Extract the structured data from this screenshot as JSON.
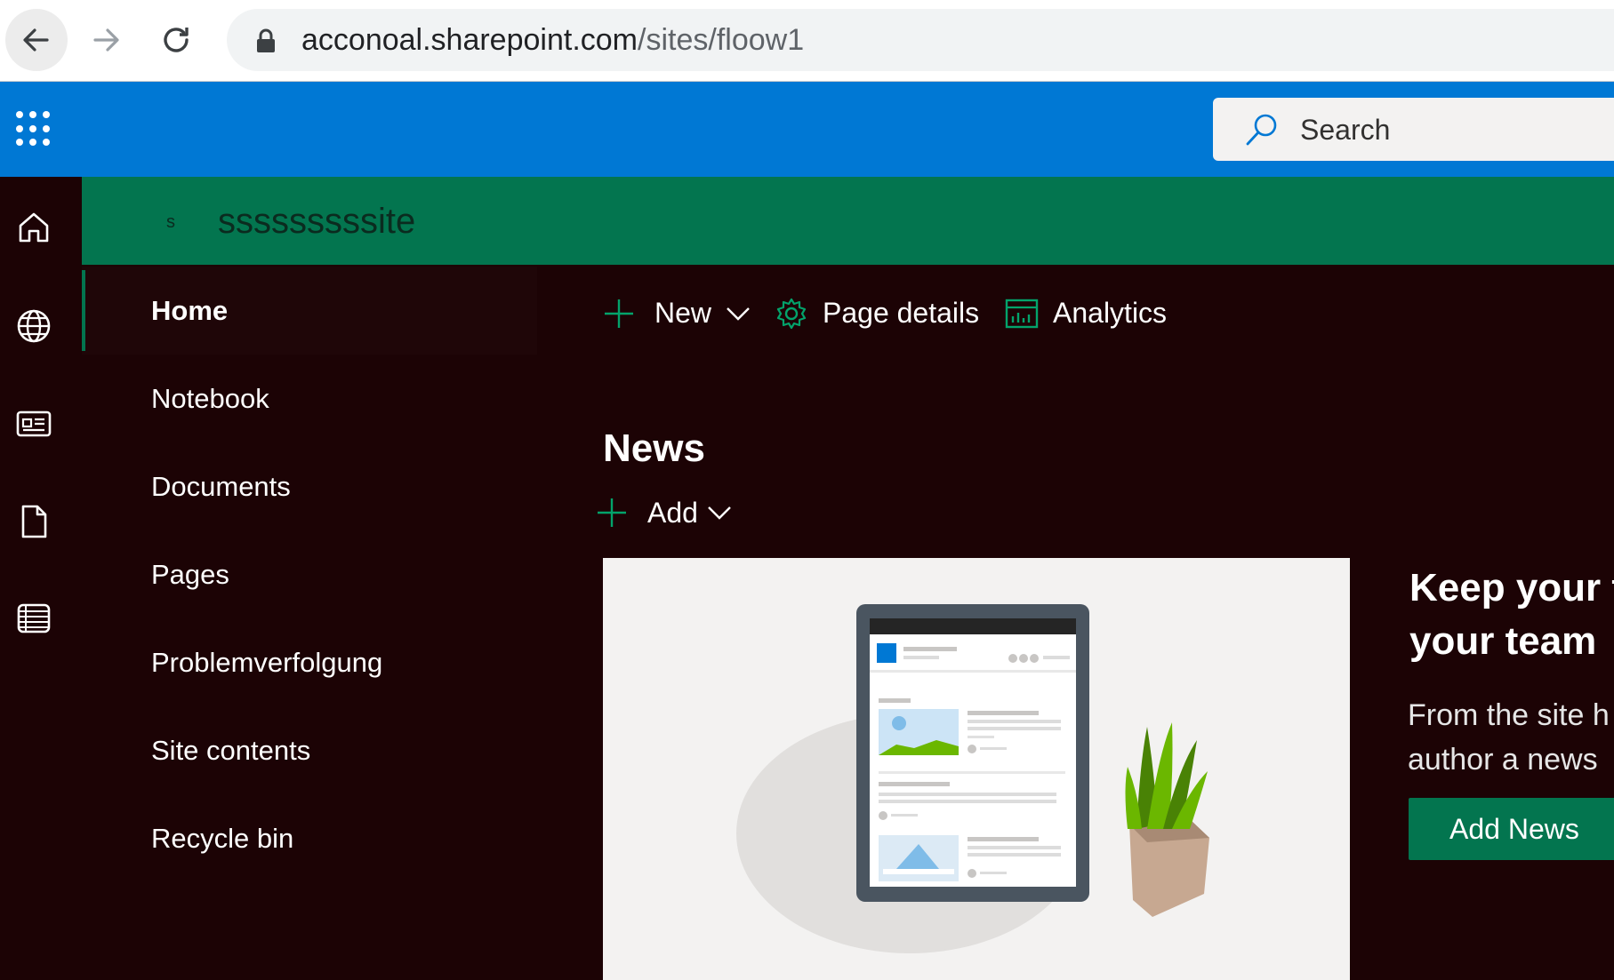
{
  "browser": {
    "url_host": "acconoal.sharepoint.com",
    "url_path": "/sites/floow1"
  },
  "suite_bar": {
    "search_placeholder": "Search"
  },
  "site": {
    "logo_letter": "s",
    "title": "sssssssssite"
  },
  "left_nav": {
    "items": [
      {
        "label": "Home",
        "selected": true
      },
      {
        "label": "Notebook"
      },
      {
        "label": "Documents"
      },
      {
        "label": "Pages"
      },
      {
        "label": "Problemverfolgung"
      },
      {
        "label": "Site contents"
      },
      {
        "label": "Recycle bin"
      }
    ]
  },
  "command_bar": {
    "new_label": "New",
    "page_details_label": "Page details",
    "analytics_label": "Analytics"
  },
  "news": {
    "title": "News",
    "add_label": "Add",
    "promo_line1": "Keep your t",
    "promo_line2": "your team",
    "promo_text_line1": "From the site h",
    "promo_text_line2": "author a news",
    "promo_button": "Add News"
  },
  "colors": {
    "suite_bar": "#0078d4",
    "site_header": "#03754f",
    "page_background": "#1c0305",
    "accent": "#03754f"
  }
}
